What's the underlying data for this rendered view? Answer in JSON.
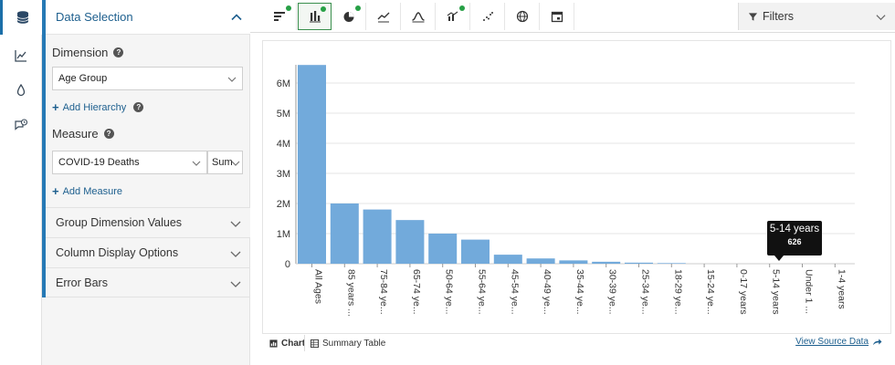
{
  "rail": {
    "items": [
      {
        "icon": "database-icon",
        "active": true
      },
      {
        "icon": "chart-line-icon",
        "active": false
      },
      {
        "icon": "droplet-icon",
        "active": false
      },
      {
        "icon": "chat-clock-icon",
        "active": false
      }
    ]
  },
  "panel": {
    "header": "Data Selection",
    "dimension_label": "Dimension",
    "dimension_value": "Age Group",
    "add_hierarchy": "Add Hierarchy",
    "measure_label": "Measure",
    "measure_value": "COVID-19 Deaths",
    "aggregation_value": "Sum",
    "add_measure": "Add Measure",
    "sections": [
      "Group Dimension Values",
      "Column Display Options",
      "Error Bars"
    ]
  },
  "toolbar": {
    "filters_label": "Filters"
  },
  "tooltip": {
    "label": "5-14 years",
    "value": "626"
  },
  "bottom": {
    "chart_tab": "Chart",
    "table_tab": "Summary Table",
    "source_link": "View Source Data"
  },
  "colors": {
    "bar": "#72aadb",
    "accent": "#2679b5",
    "active_green": "#27a046"
  },
  "chart_data": {
    "type": "bar",
    "categories": [
      "All Ages",
      "85 years ...",
      "75-84 ye...",
      "65-74 ye...",
      "50-64 ye...",
      "55-64 ye...",
      "45-54 ye...",
      "40-49 ye...",
      "35-44 ye...",
      "30-39 ye...",
      "25-34 ye...",
      "18-29 ye...",
      "15-24 ye...",
      "0-17 years",
      "5-14 years",
      "Under 1 ...",
      "1-4 years"
    ],
    "values": [
      6600000,
      2000000,
      1800000,
      1450000,
      1000000,
      800000,
      300000,
      175000,
      110000,
      65000,
      35000,
      20000,
      10000,
      1500,
      626,
      400,
      300
    ],
    "y_ticks": [
      "0",
      "1M",
      "2M",
      "3M",
      "4M",
      "5M",
      "6M"
    ],
    "ylim": [
      0,
      6500000
    ],
    "grid": true
  }
}
